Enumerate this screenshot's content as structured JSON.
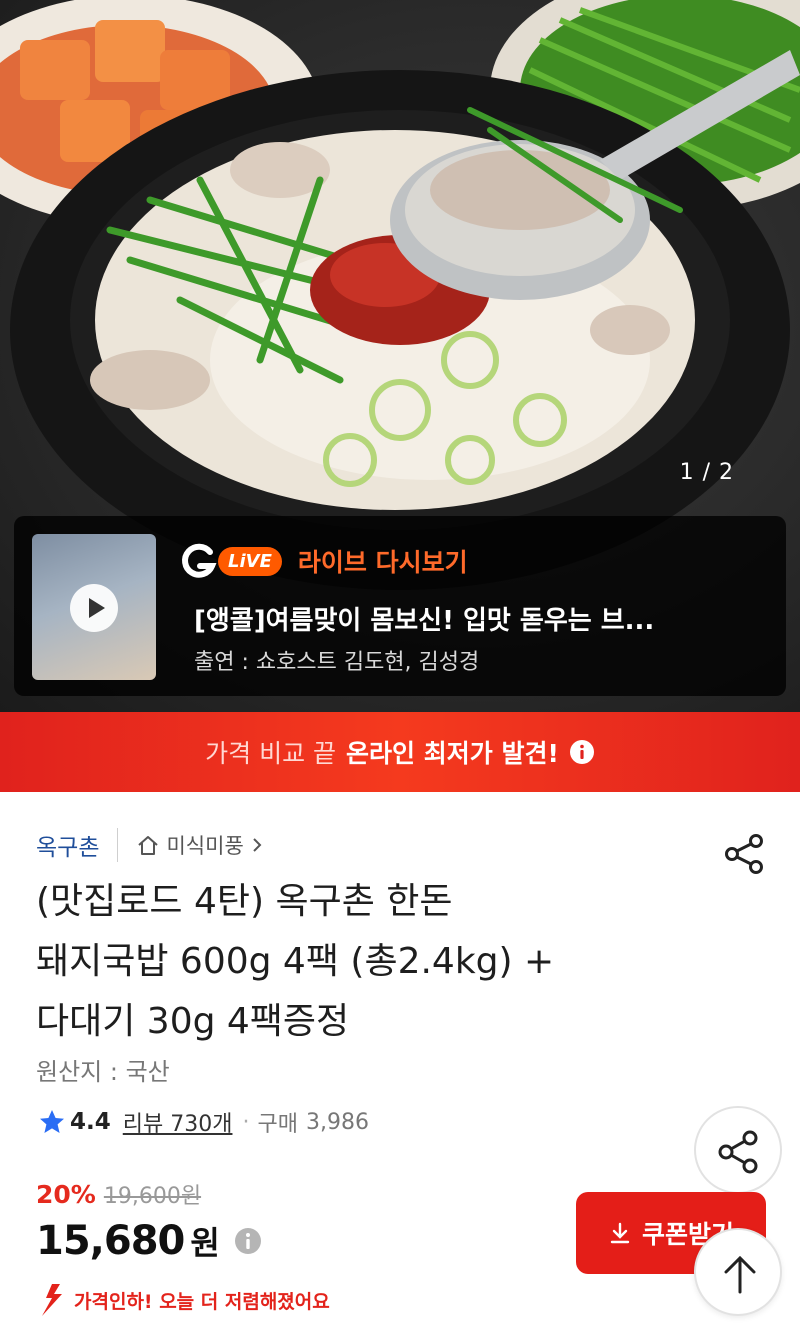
{
  "hero": {
    "counter": "1 / 2"
  },
  "live": {
    "badge": "LiVE",
    "label": "라이브 다시보기",
    "title": "[앵콜]여름맞이 몸보신! 입맛 돋우는 브...",
    "cast": "출연 : 쇼호스트 김도현, 김성경"
  },
  "banner": {
    "prefix": "가격 비교 끝",
    "highlight": "온라인 최저가 발견!"
  },
  "product": {
    "brand": "옥구촌",
    "category": "미식미풍",
    "title_lines": [
      "(맛집로드 4탄) 옥구촌 한돈",
      "돼지국밥 600g 4팩 (총2.4kg) +",
      "다대기 30g 4팩증정"
    ],
    "origin": "원산지 : 국산"
  },
  "rating": {
    "score": "4.4",
    "reviews": "리뷰 730개",
    "purchases_label": "구매",
    "purchases": "3,986"
  },
  "price": {
    "discount": "20%",
    "original": "19,600원",
    "final": "15,680",
    "currency": "원",
    "drop_notice": "가격인하! 오늘 더 저렴해졌어요"
  },
  "coupon": {
    "label": "쿠폰받기"
  },
  "icons": {
    "share": "share-icon",
    "top": "arrow-up-icon",
    "home": "home-icon",
    "info": "info-icon",
    "star": "star-icon",
    "download": "download-icon",
    "play": "play-icon"
  },
  "colors": {
    "accent_red": "#e41e18",
    "live_orange": "#ff5a00",
    "brand_blue": "#1f4e9a",
    "star_blue": "#2a6df4"
  }
}
